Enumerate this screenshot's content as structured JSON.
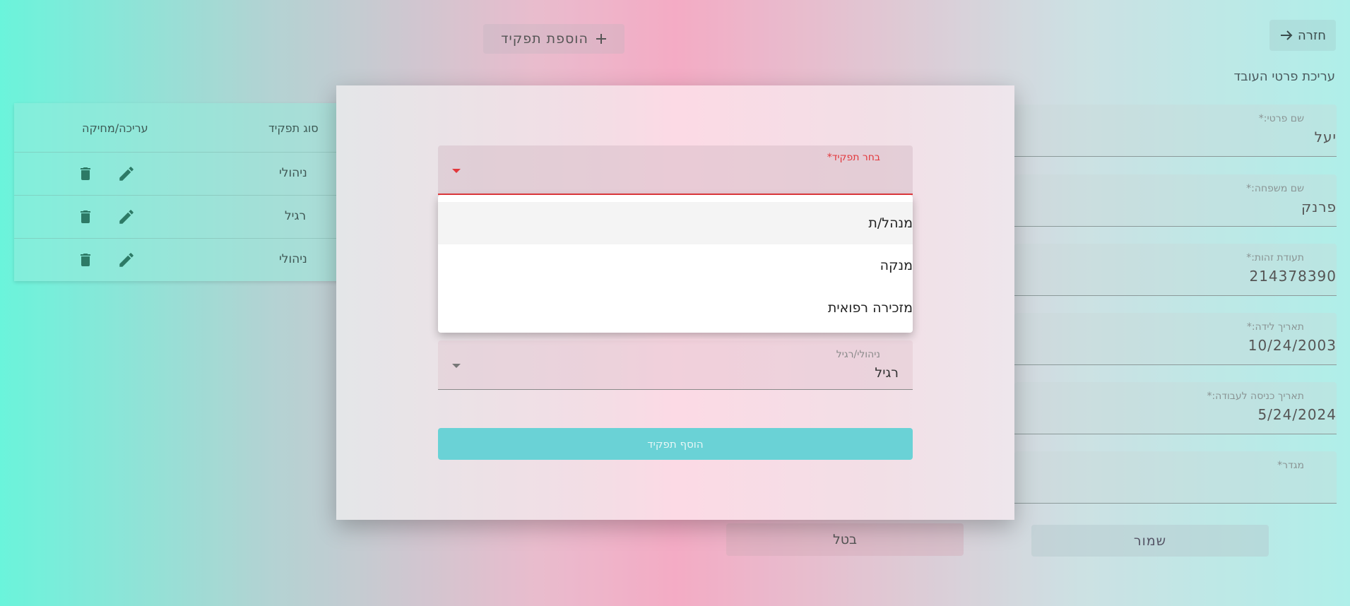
{
  "header": {
    "back_label": "חזרה",
    "add_role_label": "הוספת תפקיד",
    "page_title": "עריכת פרטי העובד"
  },
  "form": {
    "fields": [
      {
        "label": "שם פרטי:*",
        "value": "יעל"
      },
      {
        "label": "שם משפחה:*",
        "value": "פרנק"
      },
      {
        "label": "תעודת זהות:*",
        "value": "214378390"
      },
      {
        "label": "תאריך לידה:*",
        "value": "10/24/2003"
      },
      {
        "label": "תאריך כניסה לעבודה:*",
        "value": "5/24/2024"
      },
      {
        "label": "מגדר*",
        "value": ""
      }
    ],
    "save_label": "שמור",
    "cancel_label": "בטל"
  },
  "table": {
    "headers": {
      "type": "סוג תפקיד",
      "actions": "עריכה/מחיקה"
    },
    "rows": [
      {
        "type": "ניהולי"
      },
      {
        "type": "רגיל"
      },
      {
        "type": "ניהולי"
      }
    ]
  },
  "modal": {
    "role_select": {
      "label": "בחר תפקיד*",
      "value": ""
    },
    "options": [
      "מנהל/ת",
      "מנקה",
      "מזכירה רפואית"
    ],
    "type_select": {
      "label": "ניהולי/רגיל",
      "value": "רגיל"
    },
    "submit_label": "הוסף תפקיד"
  },
  "colors": {
    "error": "#e2383c",
    "accent": "#6ad2d6",
    "icon": "#2d7a66"
  }
}
